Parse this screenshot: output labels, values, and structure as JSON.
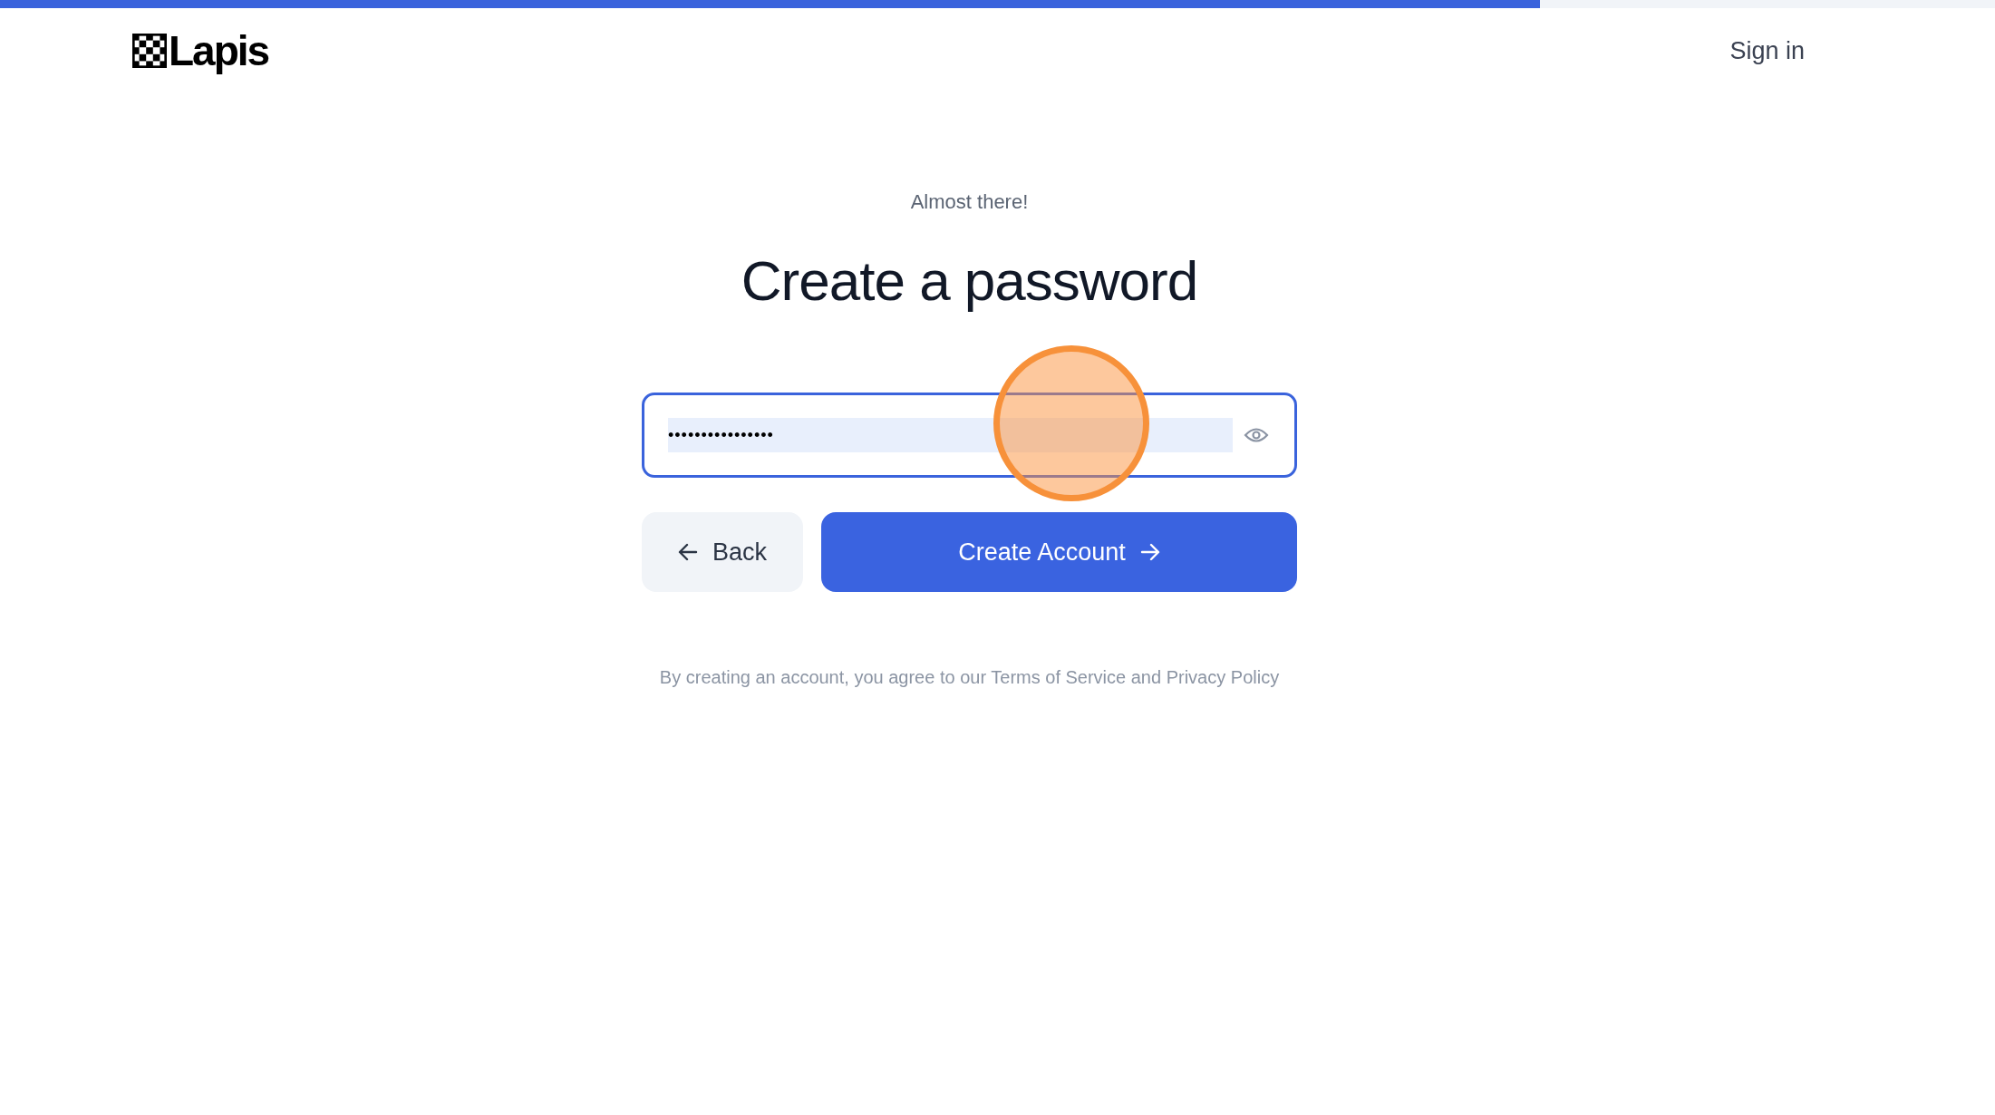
{
  "progress": {
    "level": 0.772
  },
  "header": {
    "logo_text": "Lapis",
    "sign_in": "Sign in"
  },
  "eyebrow": "Almost there!",
  "title": "Create a password",
  "password_field": {
    "value": "••••••••••••••••",
    "text_selected": true
  },
  "buttons": [
    {
      "kind": "secondary",
      "label": "Back"
    },
    {
      "kind": "primary",
      "label": "Create Account"
    }
  ],
  "legal": "By creating an account, you agree to our Terms of Service and Privacy Policy",
  "click_indicator": true
}
